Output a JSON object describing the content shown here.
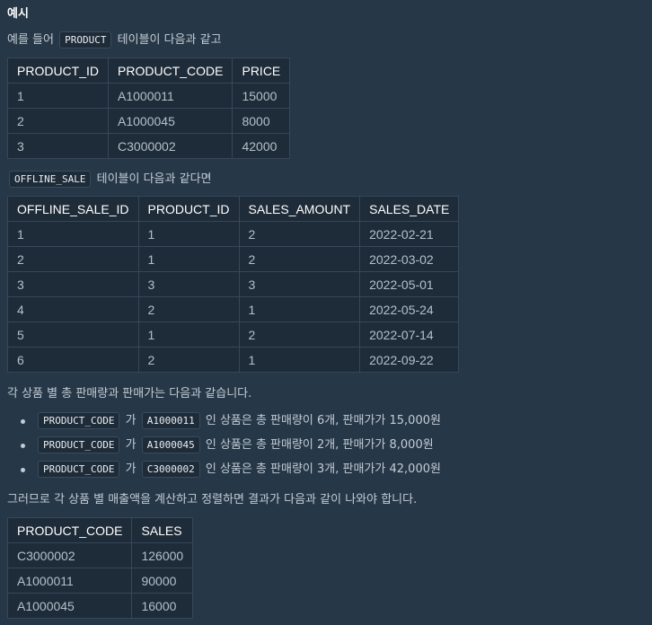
{
  "heading": "예시",
  "intro": {
    "prefix": "예를 들어",
    "code": "PRODUCT",
    "suffix": "테이블이 다음과 같고"
  },
  "product_table": {
    "headers": [
      "PRODUCT_ID",
      "PRODUCT_CODE",
      "PRICE"
    ],
    "rows": [
      [
        "1",
        "A1000011",
        "15000"
      ],
      [
        "2",
        "A1000045",
        "8000"
      ],
      [
        "3",
        "C3000002",
        "42000"
      ]
    ]
  },
  "offline_intro": {
    "code": "OFFLINE_SALE",
    "suffix": "테이블이 다음과 같다면"
  },
  "offline_table": {
    "headers": [
      "OFFLINE_SALE_ID",
      "PRODUCT_ID",
      "SALES_AMOUNT",
      "SALES_DATE"
    ],
    "rows": [
      [
        "1",
        "1",
        "2",
        "2022-02-21"
      ],
      [
        "2",
        "1",
        "2",
        "2022-03-02"
      ],
      [
        "3",
        "3",
        "3",
        "2022-05-01"
      ],
      [
        "4",
        "2",
        "1",
        "2022-05-24"
      ],
      [
        "5",
        "1",
        "2",
        "2022-07-14"
      ],
      [
        "6",
        "2",
        "1",
        "2022-09-22"
      ]
    ]
  },
  "summary_intro": "각 상품 별 총 판매량과 판매가는 다음과 같습니다.",
  "bullets": [
    {
      "code1": "PRODUCT_CODE",
      "mid": "가",
      "code2": "A1000011",
      "text": "인 상품은 총 판매량이 6개, 판매가가 15,000원"
    },
    {
      "code1": "PRODUCT_CODE",
      "mid": "가",
      "code2": "A1000045",
      "text": "인 상품은 총 판매량이 2개, 판매가가 8,000원"
    },
    {
      "code1": "PRODUCT_CODE",
      "mid": "가",
      "code2": "C3000002",
      "text": "인 상품은 총 판매량이 3개, 판매가가 42,000원"
    }
  ],
  "result_intro": "그러므로 각 상품 별 매출액을 계산하고 정렬하면 결과가 다음과 같이 나와야 합니다.",
  "result_table": {
    "headers": [
      "PRODUCT_CODE",
      "SALES"
    ],
    "rows": [
      [
        "C3000002",
        "126000"
      ],
      [
        "A1000011",
        "90000"
      ],
      [
        "A1000045",
        "16000"
      ]
    ]
  }
}
